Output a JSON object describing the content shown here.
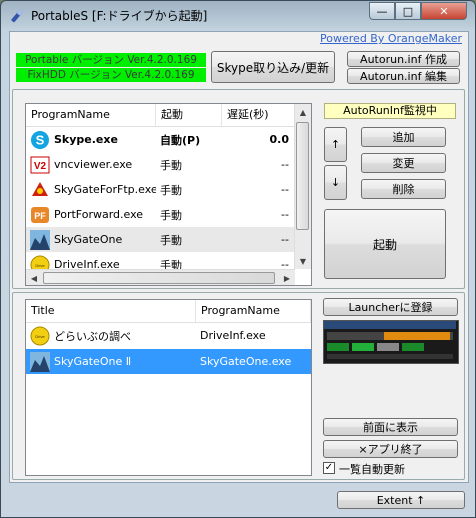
{
  "window": {
    "title": "PortableS [F:ドライブから起動]",
    "buttons": {
      "minimize": "—",
      "maximize": "□",
      "close": "✕"
    }
  },
  "powered_by": "Powered By OrangeMaker",
  "versions": {
    "portable": "Portable バージョン Ver.4.2.0.169",
    "fixhdd": "FixHDD バージョン Ver.4.2.0.169"
  },
  "top_buttons": {
    "skype_import": "Skype取り込み/更新",
    "autorun_create": "Autorun.inf 作成",
    "autorun_edit": "Autorun.inf 編集"
  },
  "program_list": {
    "columns": [
      "ProgramName",
      "起動",
      "遅延(秒)"
    ],
    "rows": [
      {
        "name": "Skype.exe",
        "launch": "自動(P)",
        "delay": "0.0",
        "icon": "skype-icon",
        "bold": true
      },
      {
        "name": "vncviewer.exe",
        "launch": "手動",
        "delay": "--",
        "icon": "vnc-icon"
      },
      {
        "name": "SkyGateForFtp.exe",
        "launch": "手動",
        "delay": "--",
        "icon": "skygate-ftp-icon"
      },
      {
        "name": "PortForward.exe",
        "launch": "手動",
        "delay": "--",
        "icon": "portforward-icon"
      },
      {
        "name": "SkyGateOne",
        "launch": "手動",
        "delay": "--",
        "icon": "skygateone-icon"
      },
      {
        "name": "DriveInf.exe",
        "launch": "手動",
        "delay": "--",
        "icon": "driveinf-icon"
      }
    ]
  },
  "right_panel": {
    "monitor_label": "AutoRunInf監視中",
    "up": "↑",
    "down": "↓",
    "add": "追加",
    "change": "変更",
    "delete": "削除",
    "launch": "起動"
  },
  "launcher_list": {
    "columns": [
      "Title",
      "ProgramName"
    ],
    "rows": [
      {
        "title": "どらいぶの調べ",
        "program": "DriveInf.exe",
        "icon": "driveinf-icon",
        "selected": false
      },
      {
        "title": "SkyGateOne Ⅱ",
        "program": "SkyGateOne.exe",
        "icon": "skygateone-icon",
        "selected": true
      }
    ]
  },
  "launcher_panel": {
    "register": "Launcherに登録",
    "bring_front": "前面に表示",
    "exit_app": "×アプリ終了",
    "auto_refresh": "一覧自動更新",
    "auto_refresh_checked": true
  },
  "extent_button": "Extent ↑",
  "colors": {
    "selection": "#3399ff",
    "version_bg": "#00ee00",
    "monitor_bg": "#ffffc0"
  }
}
